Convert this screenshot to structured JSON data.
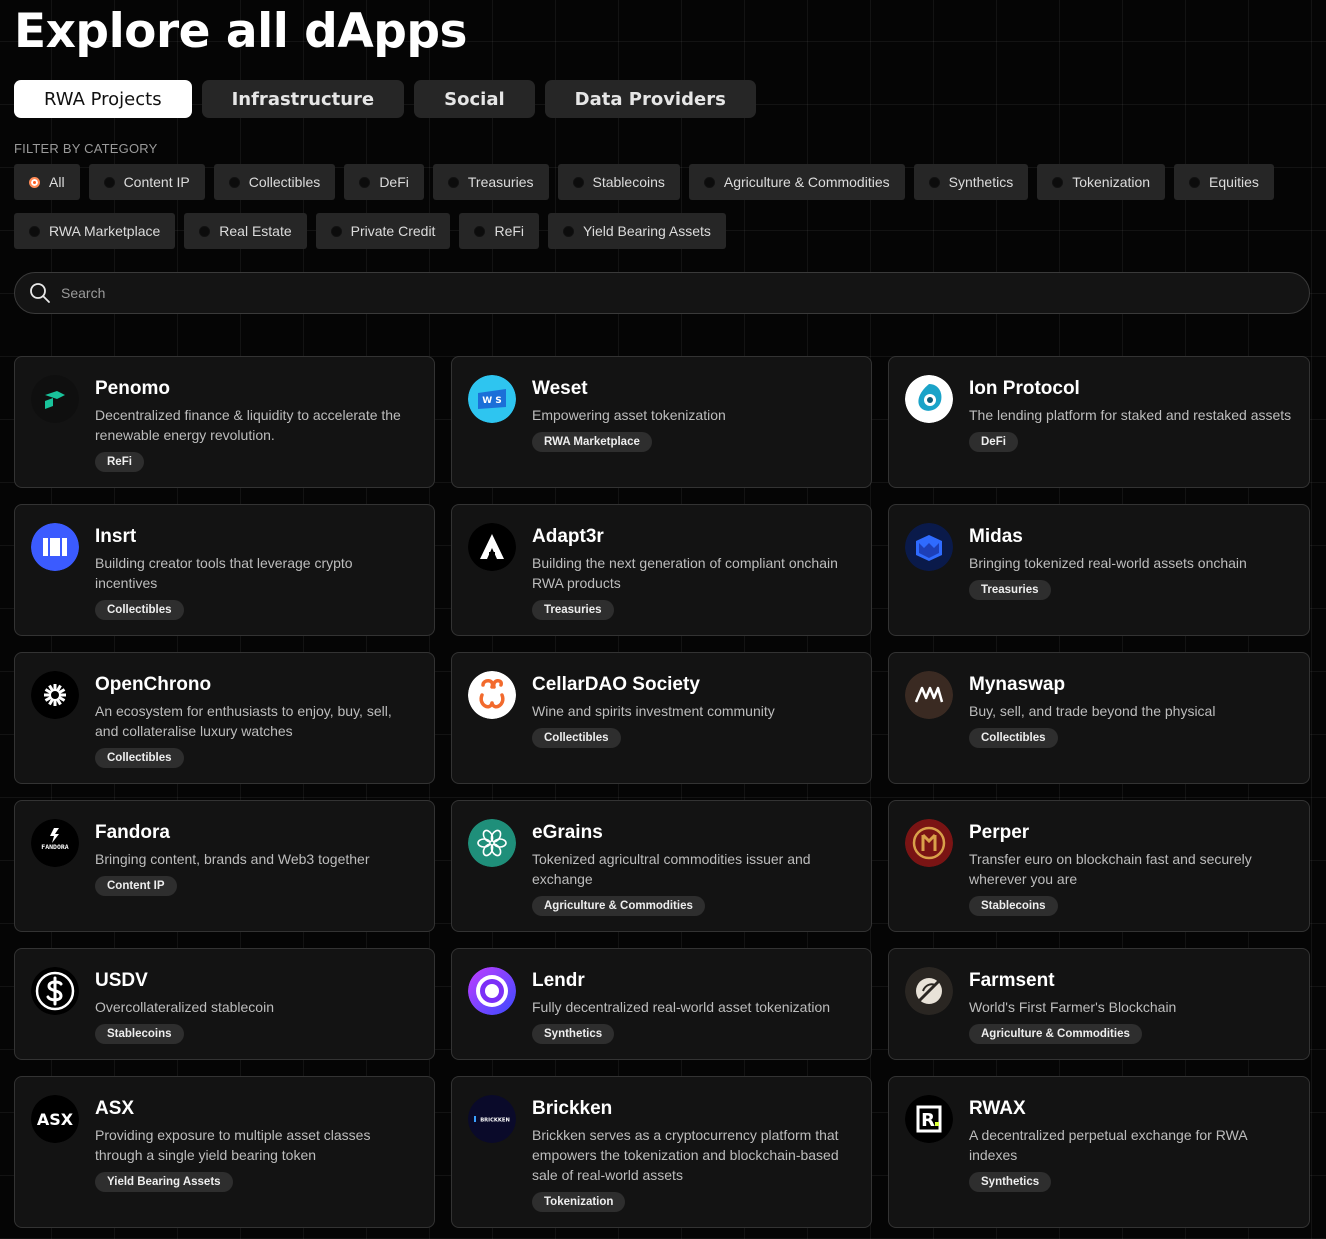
{
  "page_title": "Explore all dApps",
  "tabs": [
    {
      "label": "RWA Projects",
      "active": true
    },
    {
      "label": "Infrastructure",
      "active": false
    },
    {
      "label": "Social",
      "active": false
    },
    {
      "label": "Data Providers",
      "active": false
    }
  ],
  "filter": {
    "label": "FILTER BY CATEGORY",
    "categories": [
      {
        "label": "All",
        "active": true
      },
      {
        "label": "Content IP"
      },
      {
        "label": "Collectibles"
      },
      {
        "label": "DeFi"
      },
      {
        "label": "Treasuries"
      },
      {
        "label": "Stablecoins"
      },
      {
        "label": "Agriculture & Commodities"
      },
      {
        "label": "Synthetics"
      },
      {
        "label": "Tokenization"
      },
      {
        "label": "Equities"
      },
      {
        "label": "RWA Marketplace"
      },
      {
        "label": "Real Estate"
      },
      {
        "label": "Private Credit"
      },
      {
        "label": "ReFi"
      },
      {
        "label": "Yield Bearing Assets"
      }
    ]
  },
  "search": {
    "placeholder": "Search",
    "icon": "search-icon"
  },
  "accent_color": "#ff5a1f",
  "dapps": [
    {
      "name": "Penomo",
      "description": "Decentralized finance & liquidity to accelerate the renewable energy revolution.",
      "tag": "ReFi",
      "icon": "penomo-logo",
      "color": "#19c39b"
    },
    {
      "name": "Weset",
      "description": "Empowering asset tokenization",
      "tag": "RWA Marketplace",
      "icon": "weset-logo",
      "logo_text": "W S",
      "color": "#2ec5f0"
    },
    {
      "name": "Ion Protocol",
      "description": "The lending platform for staked and restaked assets",
      "tag": "DeFi",
      "icon": "ion-protocol-logo",
      "color": "#1aa3c8"
    },
    {
      "name": "Insrt",
      "description": "Building creator tools that leverage crypto incentives",
      "tag": "Collectibles",
      "icon": "insrt-logo",
      "color": "#3b5bff"
    },
    {
      "name": "Adapt3r",
      "description": "Building the next generation of compliant onchain RWA products",
      "tag": "Treasuries",
      "icon": "adapt3r-logo",
      "color": "#000000"
    },
    {
      "name": "Midas",
      "description": "Bringing tokenized real-world assets onchain",
      "tag": "Treasuries",
      "icon": "midas-logo",
      "color": "#2f6bff"
    },
    {
      "name": "OpenChrono",
      "description": "An ecosystem for enthusiasts to enjoy, buy, sell, and collateralise luxury watches",
      "tag": "Collectibles",
      "icon": "openchrono-logo",
      "color": "#000000"
    },
    {
      "name": "CellarDAO Society",
      "description": "Wine and spirits investment community",
      "tag": "Collectibles",
      "icon": "cellardao-logo",
      "color": "#f26a2d"
    },
    {
      "name": "Mynaswap",
      "description": "Buy, sell, and trade beyond the physical",
      "tag": "Collectibles",
      "icon": "mynaswap-logo",
      "color": "#3a2a22"
    },
    {
      "name": "Fandora",
      "description": "Bringing content, brands and Web3 together",
      "tag": "Content IP",
      "icon": "fandora-logo",
      "logo_text": "FANDORA",
      "color": "#000000"
    },
    {
      "name": "eGrains",
      "description": "Tokenized agricultral commodities issuer and exchange",
      "tag": "Agriculture & Commodities",
      "icon": "egrains-logo",
      "color": "#1f8f7a"
    },
    {
      "name": "Perper",
      "description": "Transfer euro on blockchain fast and securely wherever you are",
      "tag": "Stablecoins",
      "icon": "perper-logo",
      "color": "#7a1414"
    },
    {
      "name": "USDV",
      "description": "Overcollateralized stablecoin",
      "tag": "Stablecoins",
      "icon": "usdv-logo",
      "color": "#000000"
    },
    {
      "name": "Lendr",
      "description": "Fully decentralized real-world asset tokenization",
      "tag": "Synthetics",
      "icon": "lendr-logo",
      "color": "#7b2ff7"
    },
    {
      "name": "Farmsent",
      "description": "World's First Farmer's Blockchain",
      "tag": "Agriculture & Commodities",
      "icon": "farmsent-logo",
      "color": "#2a2622"
    },
    {
      "name": "ASX",
      "description": "Providing exposure to multiple asset classes through a single yield bearing token",
      "tag": "Yield Bearing Assets",
      "icon": "asx-logo",
      "logo_text": "ASX",
      "color": "#000000"
    },
    {
      "name": "Brickken",
      "description": "Brickken serves as a cryptocurrency platform that empowers the tokenization and blockchain-based sale of real-world assets",
      "tag": "Tokenization",
      "icon": "brickken-logo",
      "logo_text": "BRICKKEN",
      "color": "#0a0a2a"
    },
    {
      "name": "RWAX",
      "description": "A decentralized perpetual exchange for RWA indexes",
      "tag": "Synthetics",
      "icon": "rwax-logo",
      "logo_text": "R",
      "color": "#000000"
    }
  ]
}
